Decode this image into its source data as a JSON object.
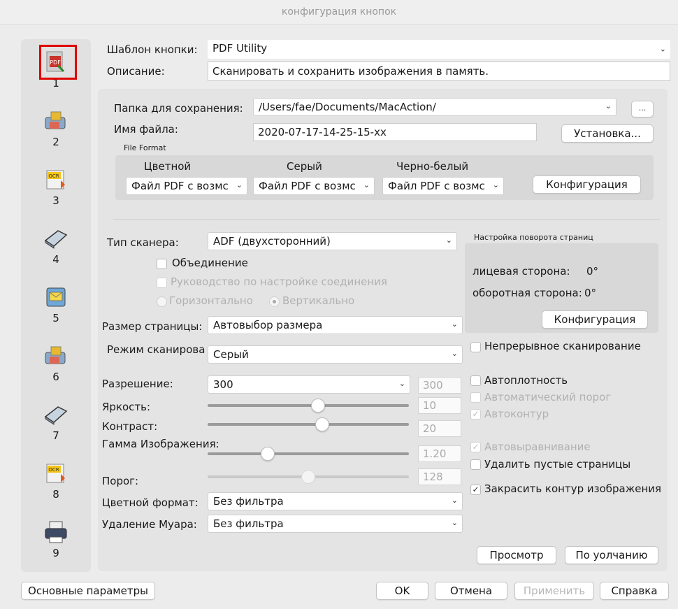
{
  "window": {
    "title": "конфигурация кнопок"
  },
  "sidebar": {
    "items": [
      {
        "num": "1",
        "icon": "pdf-utility-icon"
      },
      {
        "num": "2",
        "icon": "scan-to-folder-icon"
      },
      {
        "num": "3",
        "icon": "ocr-icon"
      },
      {
        "num": "4",
        "icon": "scanner-icon"
      },
      {
        "num": "5",
        "icon": "email-icon"
      },
      {
        "num": "6",
        "icon": "scan-to-folder-icon"
      },
      {
        "num": "7",
        "icon": "scanner-icon"
      },
      {
        "num": "8",
        "icon": "ocr-icon"
      },
      {
        "num": "9",
        "icon": "printer-icon"
      }
    ]
  },
  "template": {
    "label": "Шаблон кнопки:",
    "value": "PDF Utility"
  },
  "description": {
    "label": "Описание:",
    "value": "Сканировать и сохранить изображения в память."
  },
  "save": {
    "folder_label": "Папка для сохранения:",
    "folder_value": "/Users/fae/Documents/MacAction/",
    "browse_label": "...",
    "filename_label": "Имя файла:",
    "filename_value": "2020-07-17-14-25-15-xx",
    "setup_button": "Установка..."
  },
  "file_format": {
    "label": "File Format",
    "color_label": "Цветной",
    "gray_label": "Серый",
    "bw_label": "Черно-белый",
    "color_value": "Файл PDF с возмс",
    "gray_value": "Файл PDF с возмс",
    "bw_value": "Файл PDF с возмс",
    "config_button": "Конфигурация"
  },
  "scanner": {
    "type_label": "Тип сканера:",
    "type_value": "ADF (двухсторонний)",
    "merge_label": "Объединение",
    "guide_label": "Руководство по настройке соединения",
    "horizontal_label": "Горизонтально",
    "vertical_label": "Вертикально",
    "page_size_label": "Размер страницы:",
    "page_size_value": "Автовыбор размера",
    "mode_label": "Режим сканирова",
    "mode_value": "Серый",
    "resolution_label": "Разрешение:",
    "resolution_value": "300",
    "resolution_display": "300",
    "brightness_label": "Яркость:",
    "brightness_value": "10",
    "contrast_label": "Контраст:",
    "contrast_value": "20",
    "gamma_label": "Гамма Изображения:",
    "gamma_value": "1.20",
    "threshold_label": "Порог:",
    "threshold_value": "128",
    "color_format_label": "Цветной формат:",
    "color_format_value": "Без фильтра",
    "moire_label": "Удаление Муара:",
    "moire_value": "Без фильтра"
  },
  "rotation": {
    "title": "Настройка поворота страниц",
    "front_label": "лицевая сторона:",
    "front_value": "0°",
    "back_label": "оборотная сторона:",
    "back_value": "0°",
    "config_button": "Конфигурация"
  },
  "options": {
    "continuous": "Непрерывное сканирование",
    "autodensity": "Автоплотность",
    "autothreshold": "Автоматический порог",
    "autocontour": "Автоконтур",
    "autodeskew": "Автовыравнивание",
    "remove_blank": "Удалить пустые страницы",
    "fill_edge": "Закрасить контур изображения"
  },
  "buttons": {
    "preview": "Просмотр",
    "defaults": "По уолчанию",
    "basic": "Основные параметры",
    "ok": "OK",
    "cancel": "Отмена",
    "apply": "Применить",
    "help": "Справка"
  },
  "slider_levels": {
    "brightness": 0.55,
    "contrast": 0.57,
    "gamma": 0.3,
    "threshold": 0.5
  }
}
